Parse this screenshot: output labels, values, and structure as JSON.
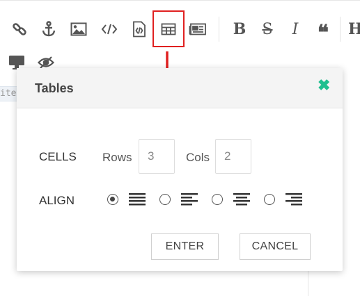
{
  "toolbar": {
    "buttons": [
      {
        "icon": "link-icon"
      },
      {
        "icon": "anchor-icon"
      },
      {
        "icon": "image-icon"
      },
      {
        "icon": "code-icon"
      },
      {
        "icon": "code-file-icon"
      },
      {
        "icon": "table-icon"
      },
      {
        "icon": "newspaper-icon"
      },
      {
        "icon": "bold-icon",
        "glyph": "B"
      },
      {
        "icon": "strikethrough-icon",
        "glyph": "S"
      },
      {
        "icon": "italic-icon",
        "glyph": "I"
      },
      {
        "icon": "quote-icon",
        "glyph": "❝"
      },
      {
        "icon": "heading-icon",
        "glyph": "H"
      }
    ],
    "row2": [
      {
        "icon": "monitor-icon"
      },
      {
        "icon": "eye-slash-icon"
      }
    ],
    "highlight_color": "#e02020"
  },
  "editor": {
    "edge_text": "ite"
  },
  "dialog": {
    "title": "Tables",
    "close_glyph": "✖",
    "close_color": "#1fbf8f",
    "cells_label": "CELLS",
    "rows_label": "Rows",
    "rows_value": "3",
    "cols_label": "Cols",
    "cols_value": "2",
    "align_label": "ALIGN",
    "align_options": [
      {
        "icon": "align-justify-icon",
        "selected": true
      },
      {
        "icon": "align-left-icon",
        "selected": false
      },
      {
        "icon": "align-center-icon",
        "selected": false
      },
      {
        "icon": "align-right-icon",
        "selected": false
      }
    ],
    "enter_label": "ENTER",
    "cancel_label": "CANCEL"
  }
}
